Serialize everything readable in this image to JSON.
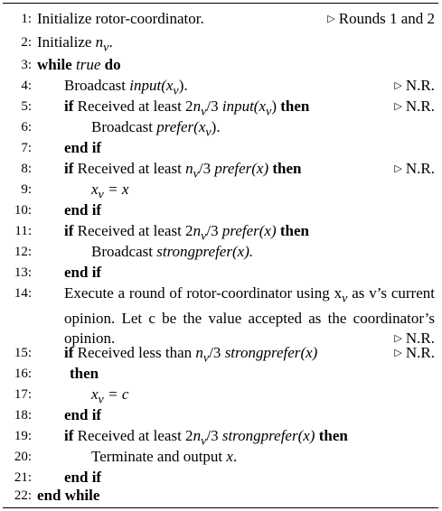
{
  "lines": [
    {
      "num": "1:",
      "text": "Initialize rotor-coordinator.",
      "comment": "Rounds 1 and 2"
    },
    {
      "num": "2:",
      "pre": "Initialize ",
      "var": "n",
      "sub": "v",
      "post": "."
    },
    {
      "num": "3:",
      "kw": "while",
      "it": "true",
      "kw2": "do"
    },
    {
      "num": "4:",
      "pre": "Broadcast ",
      "it": "input",
      "math": "(x",
      "sub": "v",
      "post": ").",
      "comment": "N.R."
    },
    {
      "num": "5:",
      "kw": "if",
      "pre": " Received at least 2",
      "var": "n",
      "sub": "v",
      "mid": "/3 ",
      "it": "input",
      "math": "(x",
      "sub2": "v",
      "post": ")",
      "kw2": "then",
      "comment": "N.R."
    },
    {
      "num": "6:",
      "pre": "Broadcast ",
      "it": "prefer",
      "math": "(x",
      "sub": "v",
      "post": ")."
    },
    {
      "num": "7:",
      "kw": "end if"
    },
    {
      "num": "8:",
      "kw": "if",
      "pre": " Received at least ",
      "var": "n",
      "sub": "v",
      "mid": "/3 ",
      "it": "prefer",
      "post": "(x)",
      "kw2": "then",
      "comment": "N.R."
    },
    {
      "num": "9:",
      "var": "x",
      "sub": "v",
      "post": " = x"
    },
    {
      "num": "10:",
      "kw": "end if"
    },
    {
      "num": "11:",
      "kw": "if",
      "pre": " Received at least 2",
      "var": "n",
      "sub": "v",
      "mid": "/3 ",
      "it": "prefer",
      "post": "(x)",
      "kw2": "then"
    },
    {
      "num": "12:",
      "pre": "Broadcast ",
      "it": "strongprefer",
      "post": "(x)."
    },
    {
      "num": "13:",
      "kw": "end if"
    },
    {
      "num": "14:",
      "text": "Execute a round of rotor-coordinator using x",
      "sub": "v",
      "text2": " as v’s current opinion. Let c be the value accepted as the coordinator’s opinion.",
      "comment": "N.R."
    },
    {
      "num": "15:",
      "kw": "if",
      "pre": " Received less than ",
      "var": "n",
      "sub": "v",
      "mid": "/3 ",
      "it": "strongprefer",
      "post": "(x)",
      "comment": "N.R."
    },
    {
      "num": "16:",
      "kw": "then"
    },
    {
      "num": "17:",
      "var": "x",
      "sub": "v",
      "post": " = c"
    },
    {
      "num": "18:",
      "kw": "end if"
    },
    {
      "num": "19:",
      "kw": "if",
      "pre": " Received at least 2",
      "var": "n",
      "sub": "v",
      "mid": "/3 ",
      "it": "strongprefer",
      "post": "(x)",
      "kw2": "then"
    },
    {
      "num": "20:",
      "pre": "Terminate and output ",
      "var": "x",
      "post": "."
    },
    {
      "num": "21:",
      "kw": "end if"
    },
    {
      "num": "22:",
      "kw": "end while"
    }
  ],
  "icons": {
    "comment_marker": "triangle-right-icon"
  }
}
